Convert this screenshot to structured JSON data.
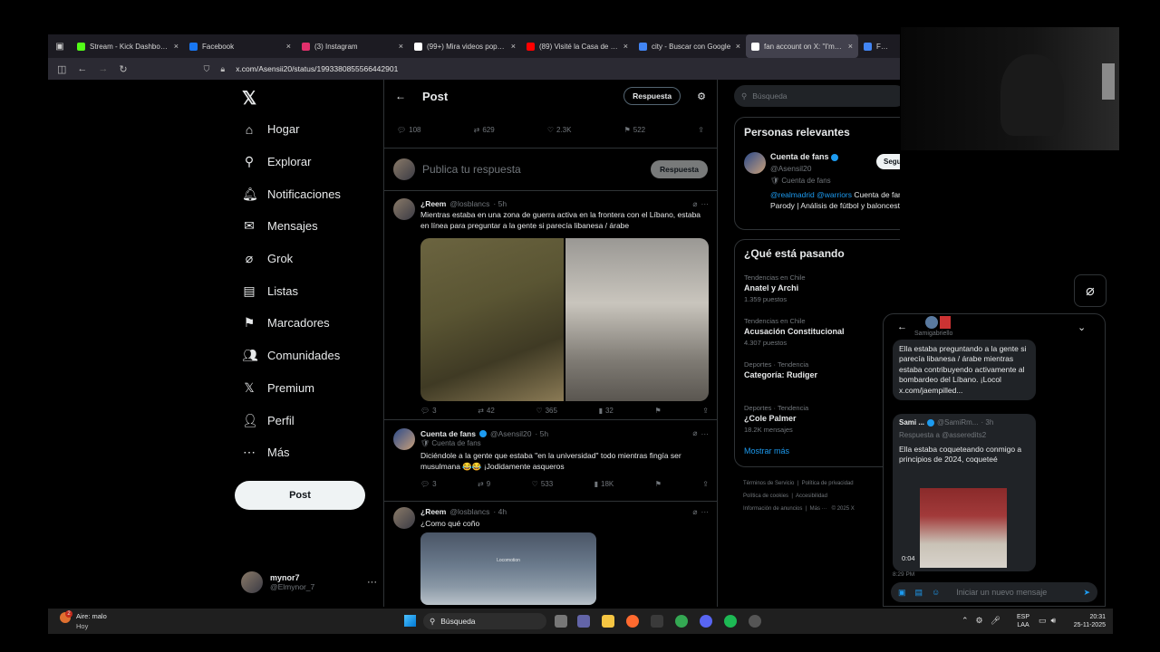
{
  "browser": {
    "tabs": [
      {
        "label": "Stream - Kick Dashboard",
        "color": "#53fc18"
      },
      {
        "label": "Facebook",
        "color": "#1877f2"
      },
      {
        "label": "(3) Instagram",
        "color": "#e1306c"
      },
      {
        "label": "(99+) Mira videos populares",
        "color": "#ffffff"
      },
      {
        "label": "(89) Visité la Casa de Messi",
        "color": "#ff0000"
      },
      {
        "label": "city - Buscar con Google",
        "color": "#4285f4"
      },
      {
        "label": "fan account on X: \"I'm cryin",
        "color": "#ffffff"
      },
      {
        "label": "FDI - Bu",
        "color": "#4285f4"
      }
    ],
    "active_tab": 6,
    "url": "x.com/Asensii20/status/1993380855566442901"
  },
  "nav": {
    "items": [
      {
        "label": "Hogar",
        "icon": "⌂"
      },
      {
        "label": "Explorar",
        "icon": "⚲"
      },
      {
        "label": "Notificaciones",
        "icon": "🔔︎"
      },
      {
        "label": "Mensajes",
        "icon": "✉"
      },
      {
        "label": "Grok",
        "icon": "⌀"
      },
      {
        "label": "Listas",
        "icon": "▤"
      },
      {
        "label": "Marcadores",
        "icon": "⚑"
      },
      {
        "label": "Comunidades",
        "icon": "👥︎"
      },
      {
        "label": "Premium",
        "icon": "𝕏"
      },
      {
        "label": "Perfil",
        "icon": "👤︎"
      },
      {
        "label": "Más",
        "icon": "⋯"
      }
    ],
    "post_button": "Post",
    "account": {
      "name": "mynor7",
      "handle": "@Elmynor_7"
    }
  },
  "header": {
    "title": "Post",
    "reply_button": "Respuesta"
  },
  "main_stats": {
    "replies": "108",
    "reposts": "629",
    "likes": "2.3K",
    "bookmarks": "522"
  },
  "composer": {
    "placeholder": "Publica tu respuesta",
    "button": "Respuesta"
  },
  "replies": [
    {
      "name": "¿Reem",
      "handle": "@losblancs",
      "time": "· 5h",
      "text": "Mientras estaba en una zona de guerra activa en la frontera con el Líbano, estaba en línea para preguntar a la gente si parecía libanesa / árabe",
      "replies": "3",
      "reposts": "42",
      "likes": "365",
      "views": "32"
    },
    {
      "name": "Cuenta de fans",
      "handle": "@Asensil20",
      "time": "· 5h",
      "badge": "Cuenta de fans",
      "text": "Diciéndole a la gente que estaba \"en la universidad\" todo mientras fingía ser musulmana 😂😂 ¡Jodidamente asqueros",
      "replies": "3",
      "reposts": "9",
      "likes": "533",
      "views": "18K"
    },
    {
      "name": "¿Reem",
      "handle": "@losblancs",
      "time": "· 4h",
      "text": "¿Como qué coño",
      "media_caption": "Locomotion"
    }
  ],
  "search": {
    "placeholder": "Búsqueda"
  },
  "relevant": {
    "title": "Personas relevantes",
    "name": "Cuenta de fans",
    "handle": "@Asensil20",
    "badge": "Cuenta de fans",
    "follow": "Seguir",
    "bio_mentions": "@realmadrid @warriors",
    "bio_text": "Cuenta de fans | Parody | Análisis de fútbol y baloncesto."
  },
  "trends": {
    "title": "¿Qué está pasando",
    "items": [
      {
        "category": "Tendencias en Chile",
        "name": "Anatel y Archi",
        "count": "1.359 puestos"
      },
      {
        "category": "Tendencias en Chile",
        "name": "Acusación Constitucional",
        "count": "4.307 puestos"
      },
      {
        "category": "Deportes · Tendencia",
        "name": "Categoría: Rudiger",
        "count": ""
      },
      {
        "category": "Deportes · Tendencia",
        "name": "¿Cole Palmer",
        "count": "18.2K mensajes"
      }
    ],
    "more": "Mostrar más"
  },
  "footer": {
    "row1": [
      "Términos de Servicio",
      "Política de privacidad"
    ],
    "row2": [
      "Política de cookies",
      "Accesibilidad"
    ],
    "row3": [
      "Información de anuncios",
      "Más ···",
      "© 2025 X"
    ]
  },
  "chat": {
    "header_name": "Samigabriello",
    "msg1": "Ella estaba preguntando a la gente si parecía libanesa / árabe mientras estaba contribuyendo activamente al bombardeo del Líbano. ¡Locol x.com/jaempilled...",
    "msg2_name": "Sami ...",
    "msg2_handle": "@SamiRm...",
    "msg2_time": "· 3h",
    "msg2_replyto": "Respuesta a @asseredits2",
    "msg2_text": "Ella estaba coqueteando conmigo a principios de 2024, coqueteé",
    "video_time": "0:04",
    "sent_time": "8:29 PM",
    "input_placeholder": "Iniciar un nuevo mensaje"
  },
  "taskbar": {
    "weather_label": "Aire: malo",
    "weather_sub": "Hoy",
    "weather_badge": "2",
    "search_label": "Búsqueda",
    "lang": "ESP",
    "lang2": "LAA",
    "time": "20:31",
    "date": "25-11-2025"
  }
}
